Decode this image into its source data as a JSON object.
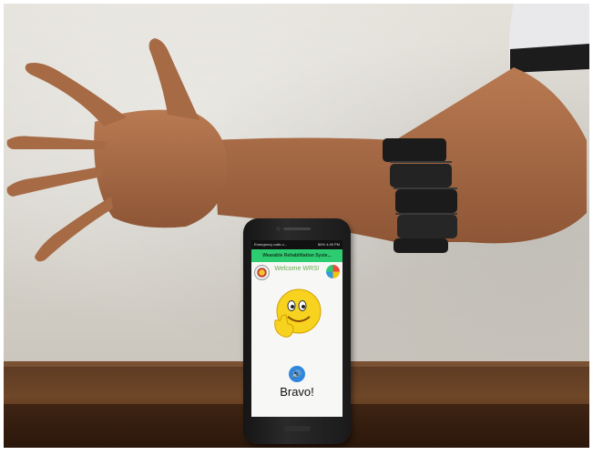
{
  "phone_screen": {
    "status_bar": {
      "carrier": "Emergency calls o...",
      "right": "86% 4:49 PM"
    },
    "app_title": "Wearable Rehabilitation Syste...",
    "welcome_text": "Welcome WRS!",
    "feedback_text": "Bravo!",
    "sound_icon": "speaker-icon",
    "emoji": "smiley-thumbs-up-emoji"
  },
  "colors": {
    "app_bar": "#2ecc71",
    "sound_button": "#2e86de",
    "armband": "#1b1b1b",
    "skin": "#a46a45"
  }
}
